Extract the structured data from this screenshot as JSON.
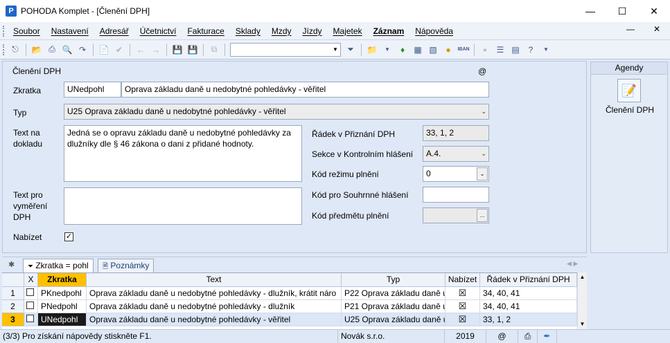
{
  "window": {
    "title": "POHODA Komplet - [Členění DPH]",
    "app_icon_letter": "P"
  },
  "menu": [
    "Soubor",
    "Nastavení",
    "Adresář",
    "Účetnictví",
    "Fakturace",
    "Sklady",
    "Mzdy",
    "Jízdy",
    "Majetek",
    "Záznam",
    "Nápověda"
  ],
  "form": {
    "title": "Členění DPH",
    "at_symbol": "@",
    "zkratka_label": "Zkratka",
    "zkratka_code": "UNedpohl",
    "zkratka_name": "Oprava základu daně u nedobytné pohledávky - věřitel",
    "typ_label": "Typ",
    "typ_value": "U25 Oprava základu daně u nedobytné pohledávky - věřitel",
    "text_doklad_label_1": "Text na",
    "text_doklad_label_2": "dokladu",
    "text_doklad_value": "Jedná se o opravu základu daně u nedobytné pohledávky za dlužníky dle § 46 zákona o dani z přidané hodnoty.",
    "text_vymereni_label_1": "Text pro",
    "text_vymereni_label_2": "vyměření",
    "text_vymereni_label_3": "DPH",
    "text_vymereni_value": "",
    "nabizet_label": "Nabízet",
    "nabizet_checked": "✓",
    "radek_label": "Řádek v Přiznání DPH",
    "radek_value": "33, 1, 2",
    "sekce_label": "Sekce v Kontrolním hlášení",
    "sekce_value": "A.4.",
    "kod_rezimu_label": "Kód režimu plnění",
    "kod_rezimu_value": "0",
    "kod_souhrnne_label": "Kód pro Souhrnné hlášení",
    "kod_souhrnne_value": "",
    "kod_predmetu_label": "Kód předmětu plnění",
    "kod_predmetu_value": "",
    "kod_predmetu_btn": "..."
  },
  "agendy": {
    "header": "Agendy",
    "item_label": "Členění DPH"
  },
  "tabs": [
    {
      "label": "Zkratka = pohl"
    },
    {
      "label": "Poznámky"
    }
  ],
  "grid": {
    "columns": {
      "x": "X",
      "zkratka": "Zkratka",
      "text": "Text",
      "typ": "Typ",
      "nabizet": "Nabízet",
      "radek": "Řádek v Přiznání DPH"
    },
    "rows": [
      {
        "n": "1",
        "zkratka": "PKnedpohl",
        "text": "Oprava základu daně u nedobytné pohledávky - dlužník, krátit náro",
        "typ": "P22 Oprava základu daně u",
        "nabizet": "☒",
        "radek": "34, 40, 41"
      },
      {
        "n": "2",
        "zkratka": "PNedpohl",
        "text": "Oprava základu daně u nedobytné pohledávky - dlužník",
        "typ": "P21 Oprava základu daně u",
        "nabizet": "☒",
        "radek": "34, 40, 41"
      },
      {
        "n": "3",
        "zkratka": "UNedpohl",
        "text": "Oprava základu daně u nedobytné pohledávky - věřitel",
        "typ": "U25 Oprava základu daně u",
        "nabizet": "☒",
        "radek": "33, 1, 2"
      }
    ]
  },
  "status": {
    "help": "(3/3) Pro získání nápovědy stiskněte F1.",
    "company": "Novák s.r.o.",
    "year": "2019",
    "at": "@"
  },
  "colors": {
    "selected_row": "#ffc000",
    "current_cell_bg": "#1a1a1a",
    "accent": "#1f66c8"
  }
}
